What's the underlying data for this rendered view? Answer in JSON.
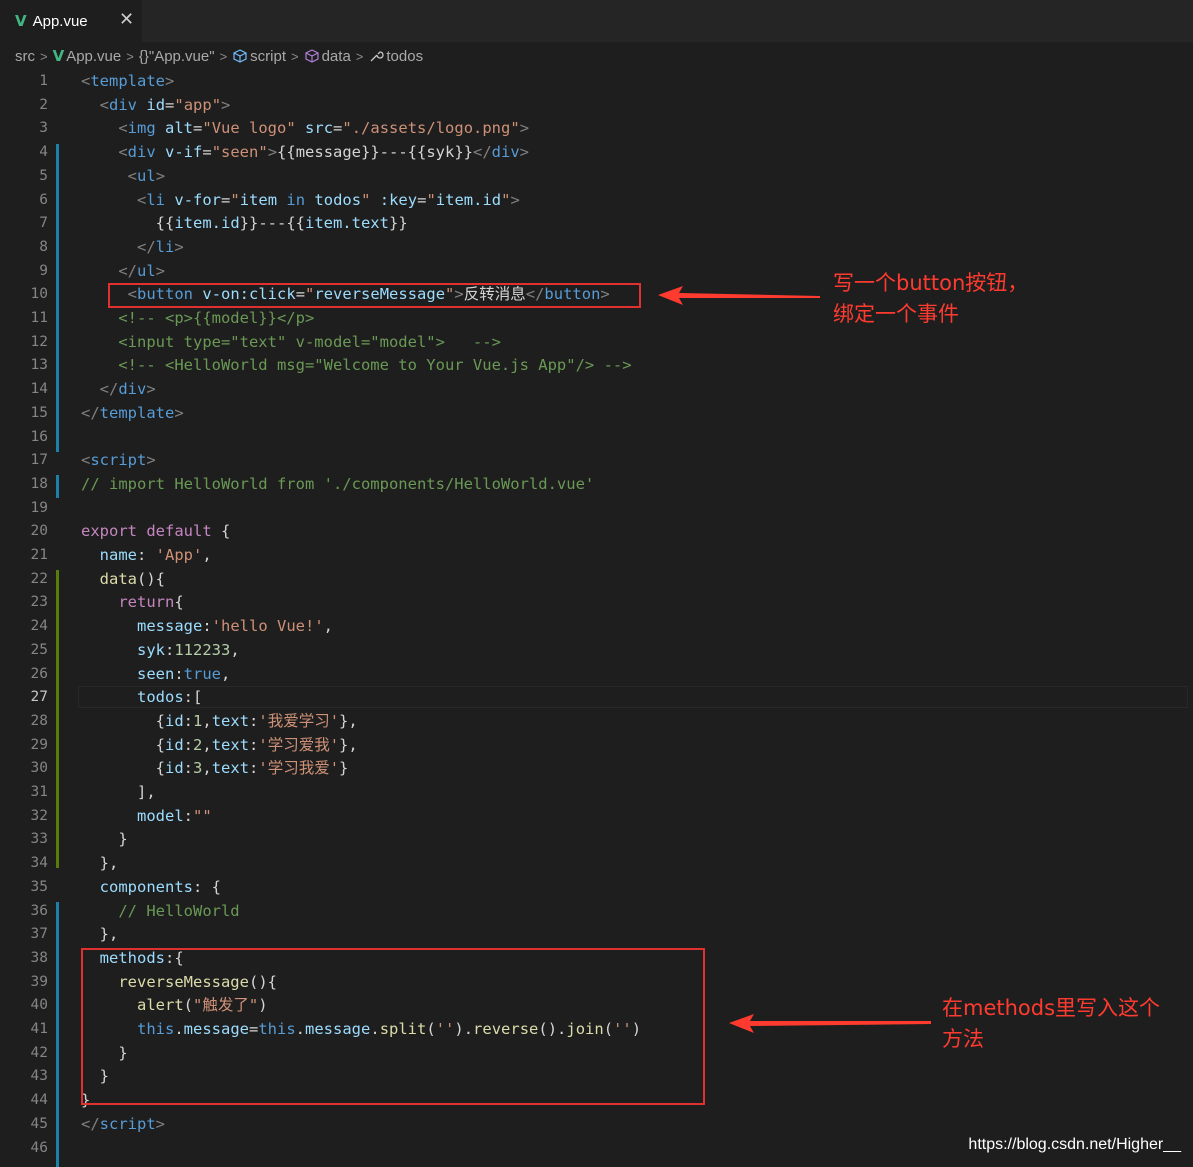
{
  "tab": {
    "icon": "vue-icon",
    "label": "App.vue",
    "close": "✕"
  },
  "breadcrumb": {
    "items": [
      {
        "icon": "",
        "label": "src"
      },
      {
        "icon": "vue-icon",
        "label": "App.vue"
      },
      {
        "icon": "braces-icon",
        "label": "{}\"App.vue\""
      },
      {
        "icon": "cube-icon",
        "label": "script"
      },
      {
        "icon": "cube-icon",
        "label": "data"
      },
      {
        "icon": "wrench-icon",
        "label": "todos"
      }
    ]
  },
  "editor": {
    "active_line": 27,
    "lines": [
      {
        "n": "1",
        "t": [
          [
            "ang",
            "<"
          ],
          [
            "tag",
            "template"
          ],
          [
            "ang",
            ">"
          ]
        ]
      },
      {
        "n": "2",
        "t": [
          [
            "txt",
            "  "
          ],
          [
            "ang",
            "<"
          ],
          [
            "tag",
            "div"
          ],
          [
            "txt",
            " "
          ],
          [
            "attr",
            "id"
          ],
          [
            "txt",
            "="
          ],
          [
            "str",
            "\"app\""
          ],
          [
            "ang",
            ">"
          ]
        ]
      },
      {
        "n": "3",
        "t": [
          [
            "txt",
            "    "
          ],
          [
            "ang",
            "<"
          ],
          [
            "tag",
            "img"
          ],
          [
            "txt",
            " "
          ],
          [
            "attr",
            "alt"
          ],
          [
            "txt",
            "="
          ],
          [
            "str",
            "\"Vue logo\""
          ],
          [
            "txt",
            " "
          ],
          [
            "attr",
            "src"
          ],
          [
            "txt",
            "="
          ],
          [
            "str",
            "\"./assets/logo.png\""
          ],
          [
            "ang",
            ">"
          ]
        ]
      },
      {
        "n": "4",
        "t": [
          [
            "txt",
            "    "
          ],
          [
            "ang",
            "<"
          ],
          [
            "tag",
            "div"
          ],
          [
            "txt",
            " "
          ],
          [
            "attr",
            "v-if"
          ],
          [
            "txt",
            "="
          ],
          [
            "str",
            "\"seen\""
          ],
          [
            "ang",
            ">"
          ],
          [
            "txt",
            "{{message}}---{{syk}}"
          ],
          [
            "ang",
            "</"
          ],
          [
            "tag",
            "div"
          ],
          [
            "ang",
            ">"
          ]
        ]
      },
      {
        "n": "5",
        "t": [
          [
            "txt",
            "     "
          ],
          [
            "ang",
            "<"
          ],
          [
            "tag",
            "ul"
          ],
          [
            "ang",
            ">"
          ]
        ]
      },
      {
        "n": "6",
        "t": [
          [
            "txt",
            "      "
          ],
          [
            "ang",
            "<"
          ],
          [
            "tag",
            "li"
          ],
          [
            "txt",
            " "
          ],
          [
            "attr",
            "v-for"
          ],
          [
            "txt",
            "="
          ],
          [
            "str",
            "\""
          ],
          [
            "prop",
            "item"
          ],
          [
            "txt",
            " "
          ],
          [
            "blue",
            "in"
          ],
          [
            "txt",
            " "
          ],
          [
            "prop",
            "todos"
          ],
          [
            "str",
            "\""
          ],
          [
            "txt",
            " "
          ],
          [
            "attr",
            ":key"
          ],
          [
            "txt",
            "="
          ],
          [
            "str",
            "\""
          ],
          [
            "prop",
            "item.id"
          ],
          [
            "str",
            "\""
          ],
          [
            "ang",
            ">"
          ]
        ]
      },
      {
        "n": "7",
        "t": [
          [
            "txt",
            "        {{"
          ],
          [
            "prop",
            "item.id"
          ],
          [
            "txt",
            "}}---{{"
          ],
          [
            "prop",
            "item.text"
          ],
          [
            "txt",
            "}}"
          ]
        ]
      },
      {
        "n": "8",
        "t": [
          [
            "txt",
            "      "
          ],
          [
            "ang",
            "</"
          ],
          [
            "tag",
            "li"
          ],
          [
            "ang",
            ">"
          ]
        ]
      },
      {
        "n": "9",
        "t": [
          [
            "txt",
            "    "
          ],
          [
            "ang",
            "</"
          ],
          [
            "tag",
            "ul"
          ],
          [
            "ang",
            ">"
          ]
        ]
      },
      {
        "n": "10",
        "t": [
          [
            "txt",
            "     "
          ],
          [
            "ang",
            "<"
          ],
          [
            "tag",
            "button"
          ],
          [
            "txt",
            " "
          ],
          [
            "attr",
            "v-on:click"
          ],
          [
            "txt",
            "="
          ],
          [
            "str",
            "\""
          ],
          [
            "prop",
            "reverseMessage"
          ],
          [
            "str",
            "\""
          ],
          [
            "ang",
            ">"
          ],
          [
            "txt",
            "反转消息"
          ],
          [
            "ang",
            "</"
          ],
          [
            "tag",
            "button"
          ],
          [
            "ang",
            ">"
          ]
        ]
      },
      {
        "n": "11",
        "t": [
          [
            "txt",
            "    "
          ],
          [
            "cm",
            "<!-- <p>{{model}}</p>"
          ]
        ]
      },
      {
        "n": "12",
        "t": [
          [
            "txt",
            "    "
          ],
          [
            "cm",
            "<input type=\"text\" v-model=\"model\">   -->"
          ]
        ]
      },
      {
        "n": "13",
        "t": [
          [
            "txt",
            "    "
          ],
          [
            "cm",
            "<!-- <HelloWorld msg=\"Welcome to Your Vue.js App\"/> -->"
          ]
        ]
      },
      {
        "n": "14",
        "t": [
          [
            "txt",
            "  "
          ],
          [
            "ang",
            "</"
          ],
          [
            "tag",
            "div"
          ],
          [
            "ang",
            ">"
          ]
        ]
      },
      {
        "n": "15",
        "t": [
          [
            "ang",
            "</"
          ],
          [
            "tag",
            "template"
          ],
          [
            "ang",
            ">"
          ]
        ]
      },
      {
        "n": "16",
        "t": []
      },
      {
        "n": "17",
        "t": [
          [
            "ang",
            "<"
          ],
          [
            "tag",
            "script"
          ],
          [
            "ang",
            ">"
          ]
        ]
      },
      {
        "n": "18",
        "t": [
          [
            "cm",
            "// import HelloWorld from './components/HelloWorld.vue'"
          ]
        ]
      },
      {
        "n": "19",
        "t": []
      },
      {
        "n": "20",
        "t": [
          [
            "kw",
            "export"
          ],
          [
            "txt",
            " "
          ],
          [
            "kw",
            "default"
          ],
          [
            "txt",
            " {"
          ]
        ]
      },
      {
        "n": "21",
        "t": [
          [
            "txt",
            "  "
          ],
          [
            "prop",
            "name"
          ],
          [
            "txt",
            ": "
          ],
          [
            "str",
            "'App'"
          ],
          [
            "txt",
            ","
          ]
        ]
      },
      {
        "n": "22",
        "t": [
          [
            "txt",
            "  "
          ],
          [
            "fn",
            "data"
          ],
          [
            "txt",
            "(){"
          ]
        ]
      },
      {
        "n": "23",
        "t": [
          [
            "txt",
            "    "
          ],
          [
            "kw",
            "return"
          ],
          [
            "txt",
            "{"
          ]
        ]
      },
      {
        "n": "24",
        "t": [
          [
            "txt",
            "      "
          ],
          [
            "prop",
            "message"
          ],
          [
            "txt",
            ":"
          ],
          [
            "str",
            "'hello Vue!'"
          ],
          [
            "txt",
            ","
          ]
        ]
      },
      {
        "n": "25",
        "t": [
          [
            "txt",
            "      "
          ],
          [
            "prop",
            "syk"
          ],
          [
            "txt",
            ":"
          ],
          [
            "num",
            "112233"
          ],
          [
            "txt",
            ","
          ]
        ]
      },
      {
        "n": "26",
        "t": [
          [
            "txt",
            "      "
          ],
          [
            "prop",
            "seen"
          ],
          [
            "txt",
            ":"
          ],
          [
            "blue",
            "true"
          ],
          [
            "txt",
            ","
          ]
        ]
      },
      {
        "n": "27",
        "t": [
          [
            "txt",
            "      "
          ],
          [
            "prop",
            "todos"
          ],
          [
            "txt",
            ":["
          ]
        ]
      },
      {
        "n": "28",
        "t": [
          [
            "txt",
            "        {"
          ],
          [
            "prop",
            "id"
          ],
          [
            "txt",
            ":"
          ],
          [
            "num",
            "1"
          ],
          [
            "txt",
            ","
          ],
          [
            "prop",
            "text"
          ],
          [
            "txt",
            ":"
          ],
          [
            "str",
            "'我爱学习'"
          ],
          [
            "txt",
            "},"
          ]
        ]
      },
      {
        "n": "29",
        "t": [
          [
            "txt",
            "        {"
          ],
          [
            "prop",
            "id"
          ],
          [
            "txt",
            ":"
          ],
          [
            "num",
            "2"
          ],
          [
            "txt",
            ","
          ],
          [
            "prop",
            "text"
          ],
          [
            "txt",
            ":"
          ],
          [
            "str",
            "'学习爱我'"
          ],
          [
            "txt",
            "},"
          ]
        ]
      },
      {
        "n": "30",
        "t": [
          [
            "txt",
            "        {"
          ],
          [
            "prop",
            "id"
          ],
          [
            "txt",
            ":"
          ],
          [
            "num",
            "3"
          ],
          [
            "txt",
            ","
          ],
          [
            "prop",
            "text"
          ],
          [
            "txt",
            ":"
          ],
          [
            "str",
            "'学习我爱'"
          ],
          [
            "txt",
            "}"
          ]
        ]
      },
      {
        "n": "31",
        "t": [
          [
            "txt",
            "      ],"
          ]
        ]
      },
      {
        "n": "32",
        "t": [
          [
            "txt",
            "      "
          ],
          [
            "prop",
            "model"
          ],
          [
            "txt",
            ":"
          ],
          [
            "str",
            "\"\""
          ]
        ]
      },
      {
        "n": "33",
        "t": [
          [
            "txt",
            "    }"
          ]
        ]
      },
      {
        "n": "34",
        "t": [
          [
            "txt",
            "  },"
          ]
        ]
      },
      {
        "n": "35",
        "t": [
          [
            "txt",
            "  "
          ],
          [
            "prop",
            "components"
          ],
          [
            "txt",
            ": {"
          ]
        ]
      },
      {
        "n": "36",
        "t": [
          [
            "txt",
            "    "
          ],
          [
            "cm",
            "// HelloWorld"
          ]
        ]
      },
      {
        "n": "37",
        "t": [
          [
            "txt",
            "  },"
          ]
        ]
      },
      {
        "n": "38",
        "t": [
          [
            "txt",
            "  "
          ],
          [
            "prop",
            "methods"
          ],
          [
            "txt",
            ":{"
          ]
        ]
      },
      {
        "n": "39",
        "t": [
          [
            "txt",
            "    "
          ],
          [
            "fn",
            "reverseMessage"
          ],
          [
            "txt",
            "(){"
          ]
        ]
      },
      {
        "n": "40",
        "t": [
          [
            "txt",
            "      "
          ],
          [
            "fn",
            "alert"
          ],
          [
            "txt",
            "("
          ],
          [
            "str",
            "\"触发了\""
          ],
          [
            "txt",
            ")"
          ]
        ]
      },
      {
        "n": "41",
        "t": [
          [
            "txt",
            "      "
          ],
          [
            "blue",
            "this"
          ],
          [
            "txt",
            "."
          ],
          [
            "prop",
            "message"
          ],
          [
            "txt",
            "="
          ],
          [
            "blue",
            "this"
          ],
          [
            "txt",
            "."
          ],
          [
            "prop",
            "message"
          ],
          [
            "txt",
            "."
          ],
          [
            "fn",
            "split"
          ],
          [
            "txt",
            "("
          ],
          [
            "str",
            "''"
          ],
          [
            "txt",
            ")."
          ],
          [
            "fn",
            "reverse"
          ],
          [
            "txt",
            "()."
          ],
          [
            "fn",
            "join"
          ],
          [
            "txt",
            "("
          ],
          [
            "str",
            "''"
          ],
          [
            "txt",
            ")"
          ]
        ]
      },
      {
        "n": "42",
        "t": [
          [
            "txt",
            "    }"
          ]
        ]
      },
      {
        "n": "43",
        "t": [
          [
            "txt",
            "  }"
          ]
        ]
      },
      {
        "n": "44",
        "t": [
          [
            "txt",
            "}"
          ]
        ]
      },
      {
        "n": "45",
        "t": [
          [
            "ang",
            "</"
          ],
          [
            "tag",
            "script"
          ],
          [
            "ang",
            ">"
          ]
        ]
      },
      {
        "n": "46",
        "t": []
      }
    ]
  },
  "annotations": {
    "note1_line1": "写一个button按钮，",
    "note1_line2": "绑定一个事件",
    "note2_line1": "在methods里写入这个",
    "note2_line2": "方法",
    "color": "#ff3b30"
  },
  "watermark": "https://blog.csdn.net/Higher__"
}
